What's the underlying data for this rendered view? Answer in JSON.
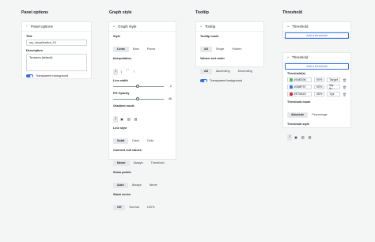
{
  "sections": {
    "panel_options": "Panel options",
    "graph_style": "Graph style",
    "tooltip": "Tooltip",
    "threshold": "Threshold"
  },
  "panel_options": {
    "header": "Panel options",
    "title_label": "Title",
    "title_value": "my_visualization_01",
    "description_label": "Description",
    "description_value": "Textarea (default)",
    "transparent_label": "Transparent background"
  },
  "graph_style": {
    "header": "Graph style",
    "style_label": "Style",
    "style_options": [
      "Lines",
      "Bars",
      "Points"
    ],
    "interpolation_label": "Interpolation",
    "interpolation_options": [
      "\\",
      "∖",
      "⌒",
      "┐"
    ],
    "line_width_label": "Line width",
    "line_width_value": "2",
    "fill_opacity_label": "Fill Opacity",
    "fill_opacity_value": "45",
    "gradient_mode_label": "Gradient mode",
    "gradient_options": [
      "⧸",
      "▣",
      "▧",
      "▨"
    ],
    "line_style_label": "Line style",
    "line_style_options": [
      "Solid",
      "Dash",
      "Dots"
    ],
    "connect_label": "Connect null values",
    "connect_options": [
      "Never",
      "Always",
      "Threshold"
    ],
    "show_points_label": "Show points",
    "show_points_options": [
      "Auto",
      "Always",
      "Never"
    ],
    "stack_label": "Stack series",
    "stack_options": [
      "Off",
      "Normal",
      "100%"
    ]
  },
  "tooltip": {
    "header": "Tooltip",
    "mode_label": "Tooltip mode",
    "mode_options": [
      "All",
      "Single",
      "Hidden"
    ],
    "sort_label": "Values sort order",
    "sort_options": [
      "All",
      "Ascending",
      "Decending"
    ],
    "transparent_label": "Transparent background"
  },
  "threshold_empty": {
    "header": "Threshold",
    "add_label": "Add a threshold"
  },
  "threshold_full": {
    "header": "Threshold",
    "add_label": "Add a threshold",
    "thresholds_label": "Threshold(s)",
    "rows": [
      {
        "color": "#3fb950",
        "hex": "#54B396",
        "pct": "90%",
        "name": "Target"
      },
      {
        "color": "#2f6feb",
        "hex": "#06BF57",
        "pct": "90%",
        "name": "My th..."
      },
      {
        "color": "#d1242f",
        "hex": "#E76640",
        "pct": "35%",
        "name": "Xyz"
      }
    ],
    "mode_label": "Threshold mode",
    "mode_options": [
      "Absolute",
      "Percentage"
    ],
    "style_label": "Threshold style",
    "style_options": [
      "⧸",
      "▣",
      "▧",
      "▨"
    ]
  },
  "colors": {
    "accent": "#2f6feb",
    "background": "#f4f5f5",
    "panel": "#ffffff"
  }
}
